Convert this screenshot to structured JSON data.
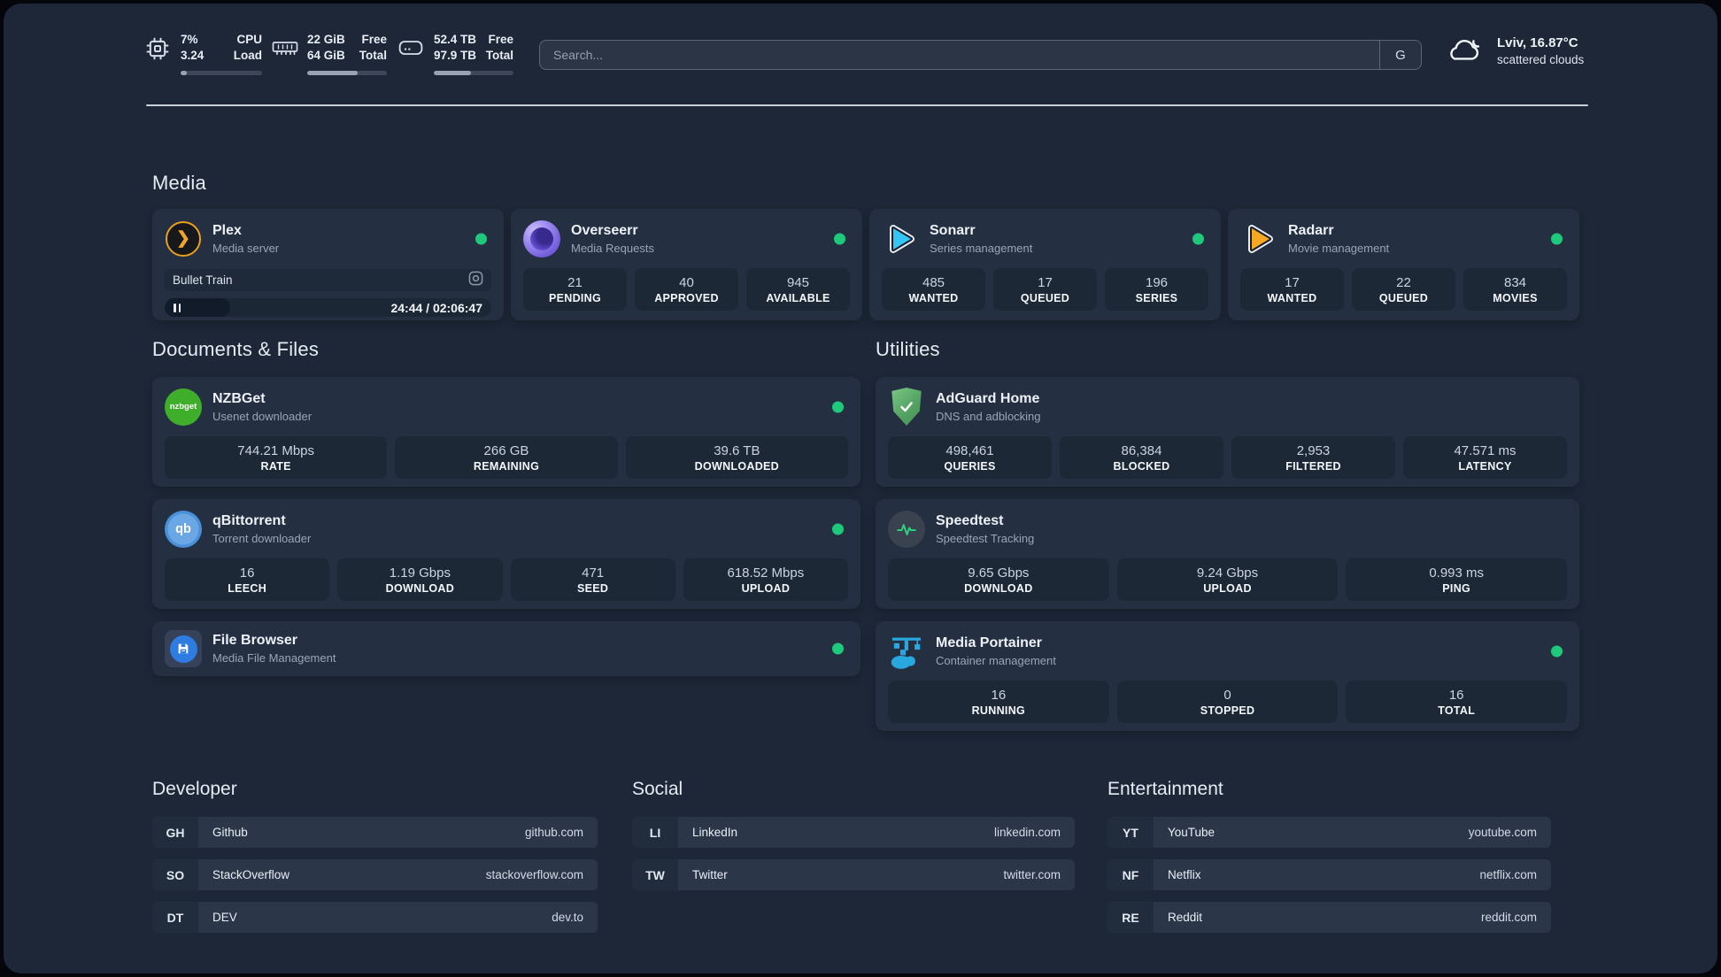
{
  "colors": {
    "page_bg": "#1d2737",
    "card_bg": "#242f41",
    "stat_box_bg": "#1d2837",
    "status_online": "#1ec97c",
    "plex_brand": "#e8a11d",
    "overseerr_brand": "#7c64e0",
    "sonarr_brand": "#35c5f4",
    "radarr_brand": "#f7a823",
    "nzbget_brand": "#3fae2a",
    "qbittorrent_brand": "#4a90d9",
    "filebrowser_brand": "#2e7ce0",
    "adguard_brand": "#55a463",
    "speedtest_pulse": "#2bd47e",
    "portainer_brand": "#29a8e0"
  },
  "header": {
    "stats": [
      {
        "name": "cpu",
        "values": [
          "7%",
          "3.24"
        ],
        "labels": [
          "CPU",
          "Load"
        ],
        "progress": "8%"
      },
      {
        "name": "memory",
        "values": [
          "22 GiB",
          "64 GiB"
        ],
        "labels": [
          "Free",
          "Total"
        ],
        "progress": "63%"
      },
      {
        "name": "storage",
        "values": [
          "52.4 TB",
          "97.9 TB"
        ],
        "labels": [
          "Free",
          "Total"
        ],
        "progress": "47%"
      }
    ],
    "search": {
      "placeholder": "Search...",
      "engine": "G"
    },
    "weather": {
      "location": "Lviv, 16.87°C",
      "condition": "scattered clouds"
    }
  },
  "media": {
    "title": "Media",
    "plex": {
      "name": "Plex",
      "desc": "Media server",
      "now_playing": "Bullet Train",
      "time": "24:44 / 02:06:47",
      "progress": "20%",
      "status": "online"
    },
    "overseerr": {
      "name": "Overseerr",
      "desc": "Media Requests",
      "status": "online",
      "stats": [
        {
          "value": "21",
          "label": "PENDING"
        },
        {
          "value": "40",
          "label": "APPROVED"
        },
        {
          "value": "945",
          "label": "AVAILABLE"
        }
      ]
    },
    "sonarr": {
      "name": "Sonarr",
      "desc": "Series management",
      "status": "online",
      "stats": [
        {
          "value": "485",
          "label": "WANTED"
        },
        {
          "value": "17",
          "label": "QUEUED"
        },
        {
          "value": "196",
          "label": "SERIES"
        }
      ]
    },
    "radarr": {
      "name": "Radarr",
      "desc": "Movie management",
      "status": "online",
      "stats": [
        {
          "value": "17",
          "label": "WANTED"
        },
        {
          "value": "22",
          "label": "QUEUED"
        },
        {
          "value": "834",
          "label": "MOVIES"
        }
      ]
    }
  },
  "documents": {
    "title": "Documents & Files",
    "nzbget": {
      "name": "NZBGet",
      "desc": "Usenet downloader",
      "badge": "nzbget",
      "status": "online",
      "stats": [
        {
          "value": "744.21 Mbps",
          "label": "RATE"
        },
        {
          "value": "266 GB",
          "label": "REMAINING"
        },
        {
          "value": "39.6 TB",
          "label": "DOWNLOADED"
        }
      ]
    },
    "qbittorrent": {
      "name": "qBittorrent",
      "desc": "Torrent downloader",
      "badge": "qb",
      "status": "online",
      "stats": [
        {
          "value": "16",
          "label": "LEECH"
        },
        {
          "value": "1.19 Gbps",
          "label": "DOWNLOAD"
        },
        {
          "value": "471",
          "label": "SEED"
        },
        {
          "value": "618.52 Mbps",
          "label": "UPLOAD"
        }
      ]
    },
    "filebrowser": {
      "name": "File Browser",
      "desc": "Media File Management",
      "status": "online"
    }
  },
  "utilities": {
    "title": "Utilities",
    "adguard": {
      "name": "AdGuard Home",
      "desc": "DNS and adblocking",
      "stats": [
        {
          "value": "498,461",
          "label": "QUERIES"
        },
        {
          "value": "86,384",
          "label": "BLOCKED"
        },
        {
          "value": "2,953",
          "label": "FILTERED"
        },
        {
          "value": "47.571 ms",
          "label": "LATENCY"
        }
      ]
    },
    "speedtest": {
      "name": "Speedtest",
      "desc": "Speedtest Tracking",
      "stats": [
        {
          "value": "9.65 Gbps",
          "label": "DOWNLOAD"
        },
        {
          "value": "9.24 Gbps",
          "label": "UPLOAD"
        },
        {
          "value": "0.993 ms",
          "label": "PING"
        }
      ]
    },
    "portainer": {
      "name": "Media Portainer",
      "desc": "Container management",
      "status": "online",
      "stats": [
        {
          "value": "16",
          "label": "RUNNING"
        },
        {
          "value": "0",
          "label": "STOPPED"
        },
        {
          "value": "16",
          "label": "TOTAL"
        }
      ]
    }
  },
  "links": {
    "developer": {
      "title": "Developer",
      "items": [
        {
          "abbr": "GH",
          "name": "Github",
          "url": "github.com"
        },
        {
          "abbr": "SO",
          "name": "StackOverflow",
          "url": "stackoverflow.com"
        },
        {
          "abbr": "DT",
          "name": "DEV",
          "url": "dev.to"
        }
      ]
    },
    "social": {
      "title": "Social",
      "items": [
        {
          "abbr": "LI",
          "name": "LinkedIn",
          "url": "linkedin.com"
        },
        {
          "abbr": "TW",
          "name": "Twitter",
          "url": "twitter.com"
        }
      ]
    },
    "entertainment": {
      "title": "Entertainment",
      "items": [
        {
          "abbr": "YT",
          "name": "YouTube",
          "url": "youtube.com"
        },
        {
          "abbr": "NF",
          "name": "Netflix",
          "url": "netflix.com"
        },
        {
          "abbr": "RE",
          "name": "Reddit",
          "url": "reddit.com"
        }
      ]
    }
  }
}
